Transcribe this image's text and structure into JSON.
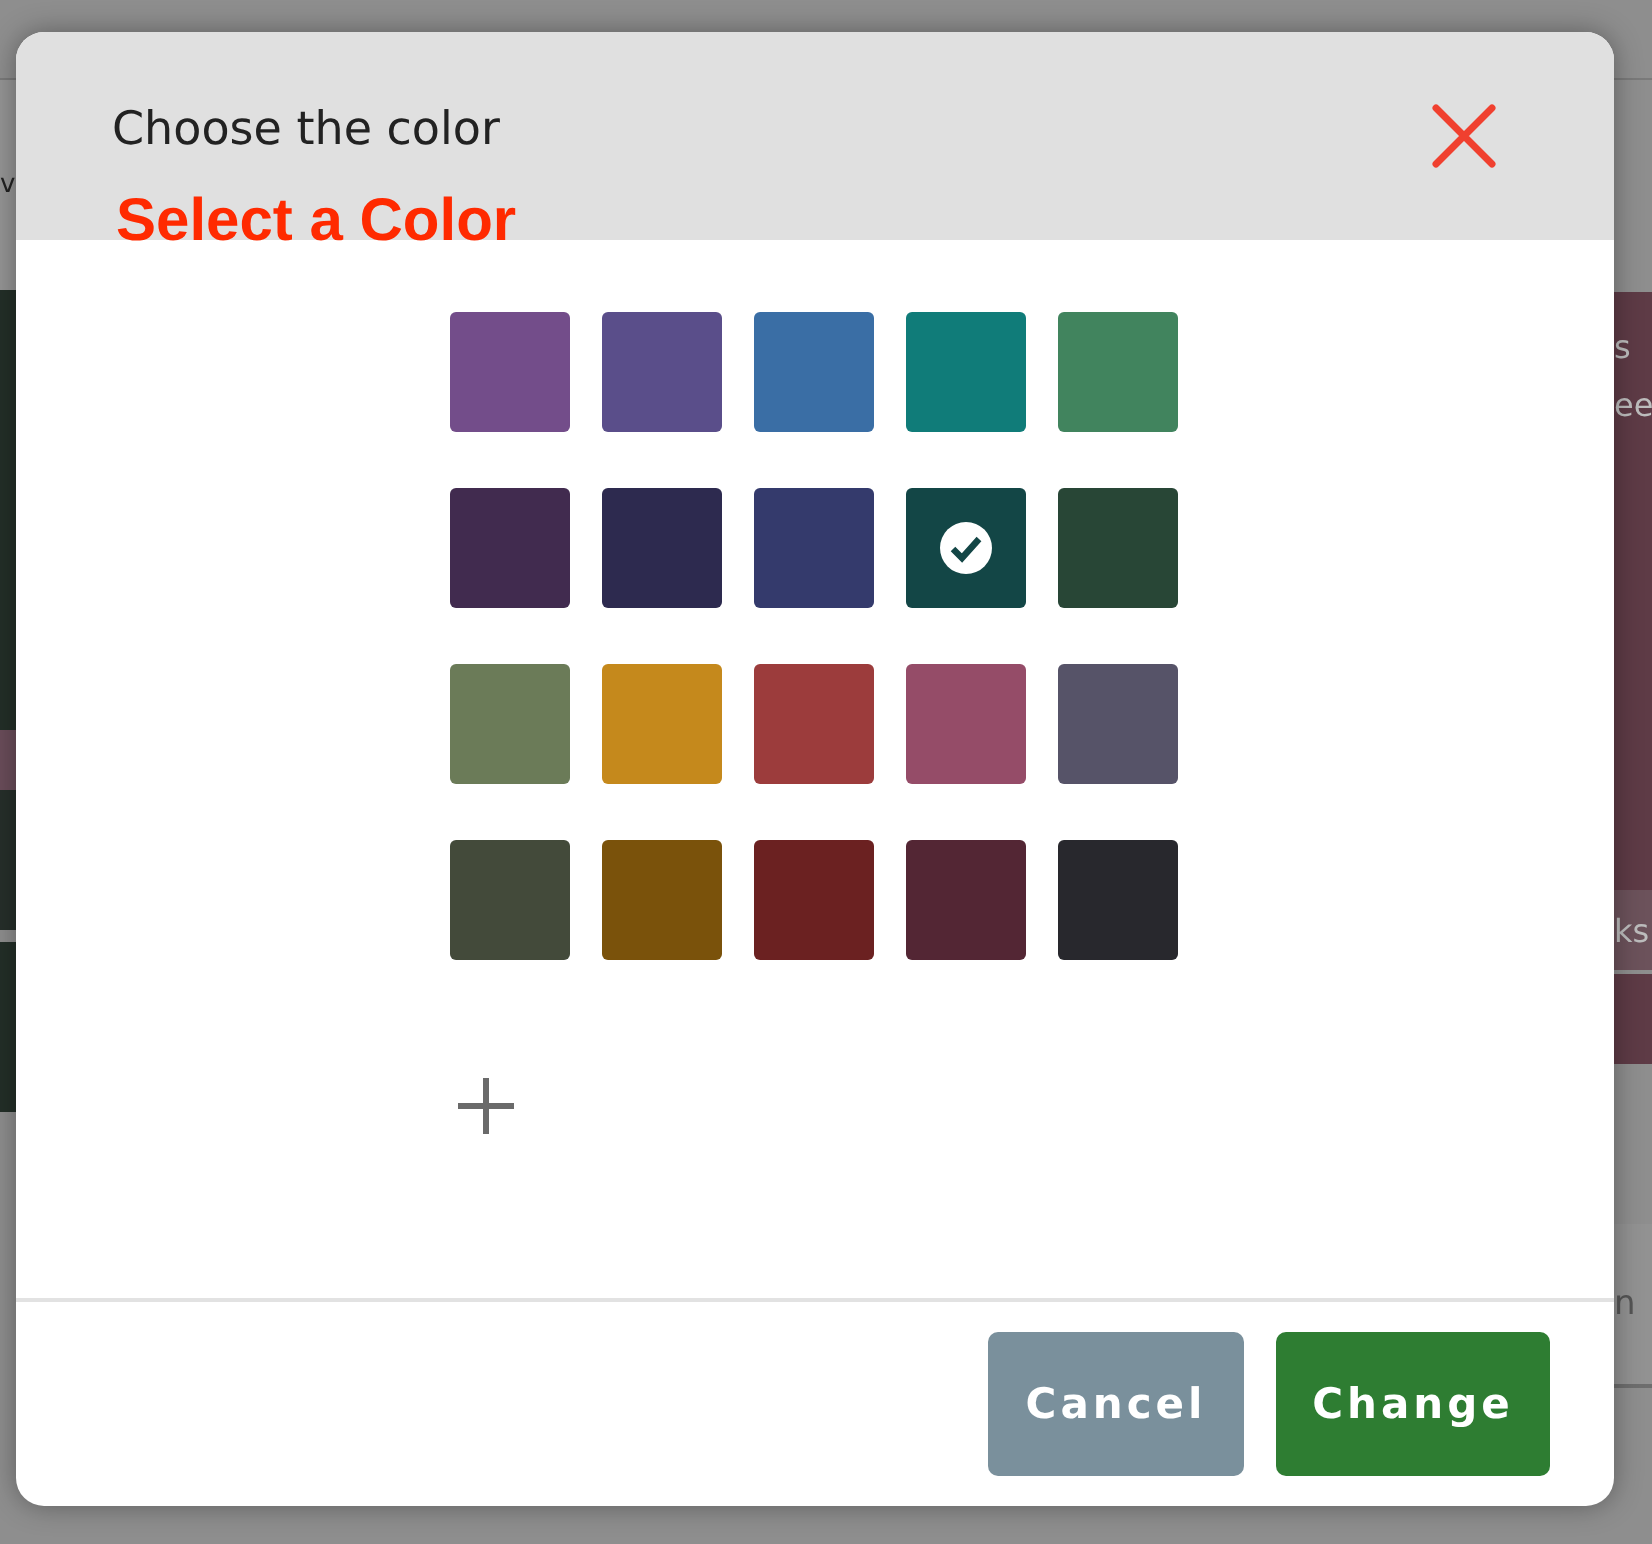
{
  "background": {
    "left_texts": [
      "v"
    ],
    "right_texts": [
      "s",
      "ee",
      "ks",
      "n"
    ]
  },
  "dialog": {
    "title": "Choose the color",
    "subtitle": "Select a Color",
    "colors": [
      {
        "color": "#734d8a",
        "selected": false
      },
      {
        "color": "#5a4e8a",
        "selected": false
      },
      {
        "color": "#3a6ea5",
        "selected": false
      },
      {
        "color": "#107c79",
        "selected": false
      },
      {
        "color": "#41845e",
        "selected": false
      },
      {
        "color": "#412b4f",
        "selected": false
      },
      {
        "color": "#2d2a4f",
        "selected": false
      },
      {
        "color": "#343a6c",
        "selected": false
      },
      {
        "color": "#134646",
        "selected": true
      },
      {
        "color": "#284636",
        "selected": false
      },
      {
        "color": "#6b7b58",
        "selected": false
      },
      {
        "color": "#c5891c",
        "selected": false
      },
      {
        "color": "#9c3c3c",
        "selected": false
      },
      {
        "color": "#954c68",
        "selected": false
      },
      {
        "color": "#565368",
        "selected": false
      },
      {
        "color": "#434a3a",
        "selected": false
      },
      {
        "color": "#7a520b",
        "selected": false
      },
      {
        "color": "#6b2121",
        "selected": false
      },
      {
        "color": "#532634",
        "selected": false
      },
      {
        "color": "#28282d",
        "selected": false
      }
    ],
    "buttons": [
      {
        "kind": "cancel",
        "label": "Cancel"
      },
      {
        "kind": "confirm",
        "label": "Change"
      }
    ]
  }
}
